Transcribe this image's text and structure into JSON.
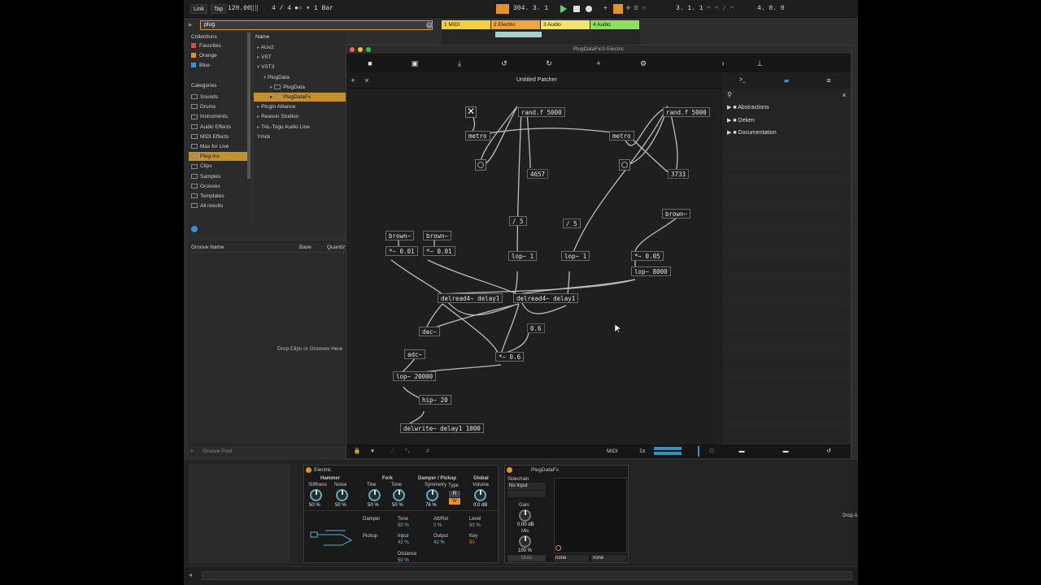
{
  "transport": {
    "link": "Link",
    "tap": "Tap",
    "tempo": "120.00",
    "signature": "4 / 4",
    "quantize": "1 Bar",
    "position": "304.  3.  1",
    "loop_start": "3.  1.  1",
    "loop_length": "4.  0.  0"
  },
  "browser": {
    "search_value": "plug",
    "collections_header": "Collections",
    "collections": [
      {
        "label": "Favorites",
        "color": "#e04b3a"
      },
      {
        "label": "Orange",
        "color": "#e8902a"
      },
      {
        "label": "Blue",
        "color": "#3b8fd8"
      }
    ],
    "categories_header": "Categories",
    "categories": [
      "Sounds",
      "Drums",
      "Instruments",
      "Audio Effects",
      "MIDI Effects",
      "Max for Live",
      "Plug-Ins",
      "Clips",
      "Samples",
      "Grooves",
      "Templates",
      "All results"
    ],
    "name_header": "Name",
    "tree": [
      "AUv2",
      "VST",
      "VST3",
      "PlugData",
      "PlugData",
      "PlugDataFx",
      "Plugin Alliance",
      "Reason Studios",
      "TAL-Togu Audio Line",
      "Ymck"
    ]
  },
  "groove": {
    "col_name": "Groove Name",
    "col_base": "Base",
    "col_quant": "Quantiz",
    "drop_text": "Drop Clips or Grooves Here",
    "pool_label": "Groove Pool"
  },
  "tracks": [
    {
      "label": "1 MIDI",
      "color": "#f0d23c"
    },
    {
      "label": "2 Electric",
      "color": "#f0a43a"
    },
    {
      "label": "3 Audio",
      "color": "#f2e66a"
    },
    {
      "label": "4 Audio",
      "color": "#8fe05a"
    }
  ],
  "plugdata": {
    "window_title": "PlugDataFx/2-Electric",
    "patch_title": "Untitled Patcher",
    "sidebar": [
      {
        "label": "Abstractions"
      },
      {
        "label": "Deken"
      },
      {
        "label": "Documentation"
      }
    ],
    "status": {
      "midi": "MIDI",
      "zoom": "1x"
    },
    "objects": {
      "rand1": "rand.f 5000",
      "metro1": "metro",
      "num1": "4657",
      "rand2": "rand.f 5000",
      "metro2": "metro",
      "num2": "3733",
      "div1": "/ 5",
      "div2": "/ 5",
      "brown3": "brown~",
      "brown1": "brown~",
      "brown2": "brown~",
      "mul1": "*~ 0.01",
      "mul2": "*~ 0.01",
      "lop1": "lop~ 1",
      "lop2": "lop~ 1",
      "mul3": "*~ 0.05",
      "lop3": "lop~ 8000",
      "delread1": "delread4~ delay1",
      "delread2": "delread4~ delay1",
      "dac": "dac~",
      "num3": "0.6",
      "adc": "adc~",
      "mul4": "*~ 0.6",
      "lop4": "lop~ 20000",
      "hip": "hip~ 20",
      "delwrite": "delwrite~ delay1 1000"
    }
  },
  "electric": {
    "title": "Electric",
    "sections": {
      "hammer": "Hammer",
      "fork": "Fork",
      "damper": "Damper / Pickup",
      "global": "Global"
    },
    "knobs": [
      {
        "label": "Stiffness",
        "value": "50 %"
      },
      {
        "label": "Noise",
        "value": "50 %"
      },
      {
        "label": "Tine",
        "value": "50 %"
      },
      {
        "label": "Tone",
        "value": "50 %"
      },
      {
        "label": "Symmetry",
        "value": "76 %"
      },
      {
        "label": "Volume",
        "value": "0.0 dB"
      }
    ],
    "type_label": "Type",
    "type_r": "R",
    "type_w": "W",
    "params": {
      "damper": "Damper",
      "damper_tone": "Tone",
      "damper_tone_val": "50 %",
      "attrel": "Att/Rel",
      "attrel_val": "0 %",
      "level": "Level",
      "level_val": "50 %",
      "pickup": "Pickup",
      "input": "Input",
      "input_val": "42 %",
      "output": "Output",
      "output_val": "42 %",
      "key": "Key",
      "key_val": "50",
      "distance": "Distance",
      "distance_val": "50 %"
    }
  },
  "plugdatafx": {
    "title": "PlugDataFx",
    "sidechain": "Sidechain",
    "no_input": "No Input",
    "gain": "Gain",
    "gain_val": "0.00 dB",
    "mix": "Mix",
    "mix_val": "100 %",
    "mute": "Mute",
    "none1": "none",
    "none2": "none"
  },
  "right_drop": "Drop A"
}
